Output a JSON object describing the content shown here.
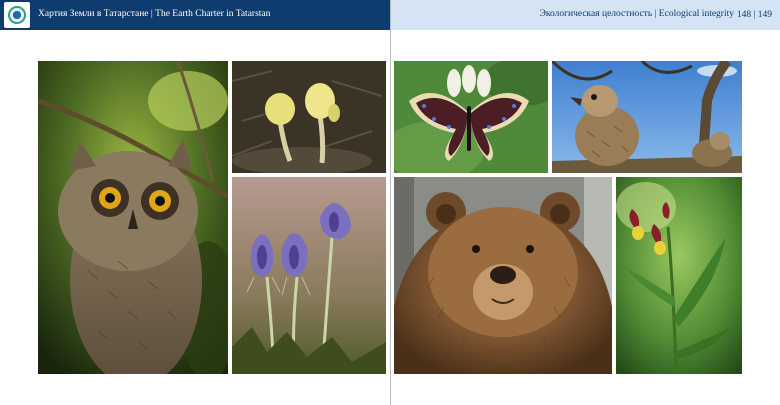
{
  "left_page": {
    "header_title": "Хартия Земли в Татарстане | The Earth Charter in Tatarstan"
  },
  "right_page": {
    "header_title": "Экологическая целостность | Ecological integrity",
    "page_numbers": "148 | 149"
  },
  "photos": [
    {
      "subject": "owl"
    },
    {
      "subject": "yellow-flowers"
    },
    {
      "subject": "pasque-flowers"
    },
    {
      "subject": "butterfly"
    },
    {
      "subject": "eagle-chicks"
    },
    {
      "subject": "brown-bear"
    },
    {
      "subject": "orchid"
    }
  ]
}
